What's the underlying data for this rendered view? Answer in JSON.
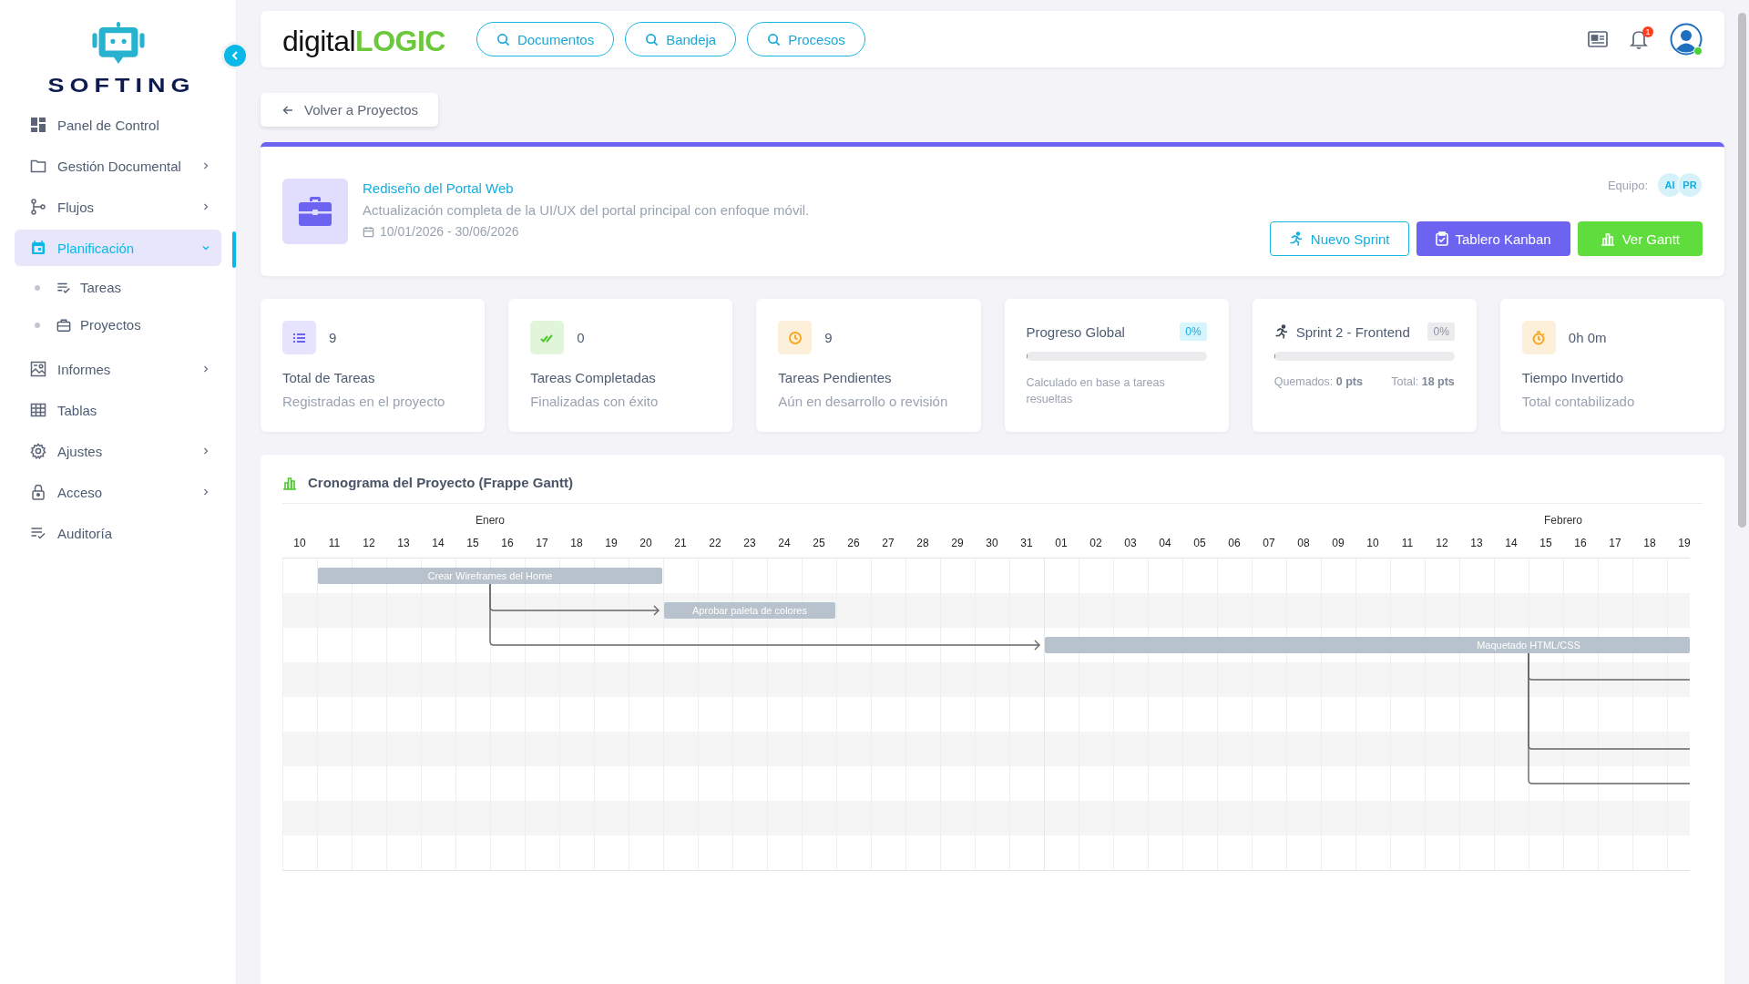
{
  "sidebar": {
    "brand": "SOFTING",
    "items": [
      {
        "label": "Panel de Control",
        "kind": "link",
        "selected": false
      },
      {
        "label": "Gestión Documental",
        "kind": "group",
        "expanded": false,
        "selected": false
      },
      {
        "label": "Flujos",
        "kind": "group",
        "expanded": false,
        "selected": false
      },
      {
        "label": "Planificación",
        "kind": "group",
        "expanded": true,
        "selected": true,
        "children": [
          {
            "label": "Tareas",
            "selected": false
          },
          {
            "label": "Proyectos",
            "selected": false
          }
        ]
      },
      {
        "label": "Informes",
        "kind": "group",
        "expanded": false,
        "selected": false
      },
      {
        "label": "Tablas",
        "kind": "link",
        "selected": false
      },
      {
        "label": "Ajustes",
        "kind": "group",
        "expanded": false,
        "selected": false
      },
      {
        "label": "Acceso",
        "kind": "group",
        "expanded": false,
        "selected": false
      },
      {
        "label": "Auditoría",
        "kind": "link",
        "selected": false
      }
    ]
  },
  "topbar": {
    "logo": "digital**LOGIC**",
    "searches": [
      "Documentos",
      "Bandeja",
      "Procesos"
    ],
    "notifications": "1",
    "user_online": true
  },
  "back_button": "Volver a Proyectos",
  "project": {
    "title": "Rediseño del Portal Web",
    "description": "Actualización completa de la UI/UX del portal principal con enfoque móvil.",
    "dates": "10/01/2026 - 30/06/2026",
    "team_label": "Equipo:",
    "team": [
      "AI",
      "PR"
    ],
    "actions": [
      {
        "label": "Nuevo Sprint",
        "kind": "outline"
      },
      {
        "label": "Tablero Kanban",
        "kind": "primary"
      },
      {
        "label": "Ver Gantt",
        "kind": "success"
      }
    ]
  },
  "stats": [
    {
      "kind": "metric",
      "color": "#6c63f0",
      "value": "9",
      "title": "Total de Tareas",
      "subtitle": "Registradas en el proyecto"
    },
    {
      "kind": "metric",
      "color": "#4cc72c",
      "value": "0",
      "title": "Tareas Completadas",
      "subtitle": "Finalizadas con éxito"
    },
    {
      "kind": "metric",
      "color": "#f5a623",
      "value": "9",
      "title": "Tareas Pendientes",
      "subtitle": "Aún en desarrollo o revisión"
    },
    {
      "kind": "progress",
      "title": "Progreso Global",
      "badge": "0%",
      "level": 0,
      "note": "Calculado en base a tareas resueltas"
    },
    {
      "kind": "sprint",
      "title": "Sprint 2 - Frontend",
      "badge": "0%",
      "level": 0,
      "burned": "Quemados: **0 pts**",
      "total": "Total: **18 pts**"
    },
    {
      "kind": "metric",
      "color": "#f5a623",
      "value": "0h 0m",
      "title": "Tiempo Invertido",
      "subtitle": "Total contabilizado"
    }
  ],
  "gantt": {
    "title": "Cronograma del Proyecto (Frappe Gantt)",
    "months": [
      {
        "label": "Enero",
        "days": [
          "10",
          "11",
          "12",
          "13",
          "14",
          "15",
          "16",
          "17",
          "18",
          "19",
          "20",
          "21",
          "22",
          "23",
          "24",
          "25",
          "26",
          "27",
          "28",
          "29",
          "30",
          "31"
        ]
      },
      {
        "label": "Febrero",
        "days": [
          "01",
          "02",
          "03",
          "04",
          "05",
          "06",
          "07",
          "08",
          "09",
          "10",
          "11",
          "12",
          "13",
          "14",
          "15",
          "16",
          "17",
          "18",
          "19"
        ]
      }
    ],
    "rows": [
      {
        "kind": "bar",
        "name": "Crear Wireframes del Home",
        "linked": false
      },
      {
        "kind": "bar",
        "name": "Aprobar paleta de colores",
        "linked": true
      },
      {
        "kind": "bar",
        "name": "Maquetado HTML/CSS",
        "linked": true
      },
      {
        "kind": "link-only"
      },
      {
        "kind": "empty"
      },
      {
        "kind": "link-only"
      },
      {
        "kind": "link-only"
      },
      {
        "kind": "empty"
      },
      {
        "kind": "empty"
      }
    ]
  }
}
